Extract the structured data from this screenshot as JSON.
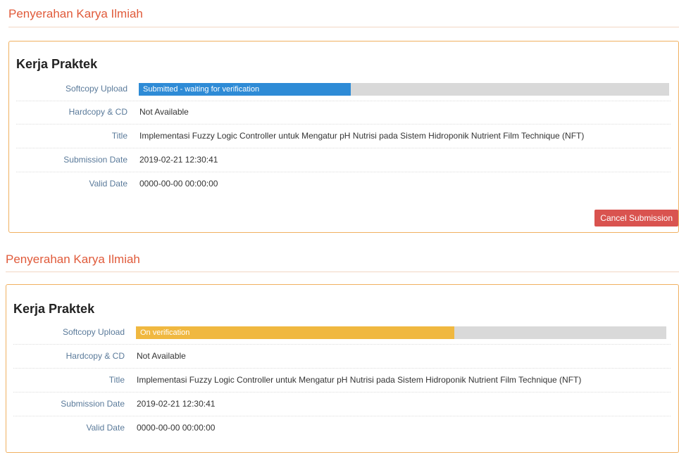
{
  "submissions": [
    {
      "section_title": "Penyerahan Karya Ilmiah",
      "card_title": "Kerja Praktek",
      "labels": {
        "softcopy": "Softcopy Upload",
        "hardcopy": "Hardcopy & CD",
        "title": "Title",
        "submission_date": "Submission Date",
        "valid_date": "Valid Date"
      },
      "softcopy_status": "Submitted - waiting for verification",
      "softcopy_progress": 0.4,
      "softcopy_color": "#2e8bd6",
      "hardcopy": "Not Available",
      "title": "Implementasi Fuzzy Logic Controller untuk Mengatur pH Nutrisi pada Sistem Hidroponik Nutrient Film Technique (NFT)",
      "submission_date": "2019-02-21 12:30:41",
      "valid_date": "0000-00-00 00:00:00",
      "cancel_label": "Cancel Submission"
    },
    {
      "section_title": "Penyerahan Karya Ilmiah",
      "card_title": "Kerja Praktek",
      "labels": {
        "softcopy": "Softcopy Upload",
        "hardcopy": "Hardcopy & CD",
        "title": "Title",
        "submission_date": "Submission Date",
        "valid_date": "Valid Date"
      },
      "softcopy_status": "On verification",
      "softcopy_progress": 0.6,
      "softcopy_color": "#f0b840",
      "hardcopy": "Not Available",
      "title": "Implementasi Fuzzy Logic Controller untuk Mengatur pH Nutrisi pada Sistem Hidroponik Nutrient Film Technique (NFT)",
      "submission_date": "2019-02-21 12:30:41",
      "valid_date": "0000-00-00 00:00:00"
    }
  ]
}
